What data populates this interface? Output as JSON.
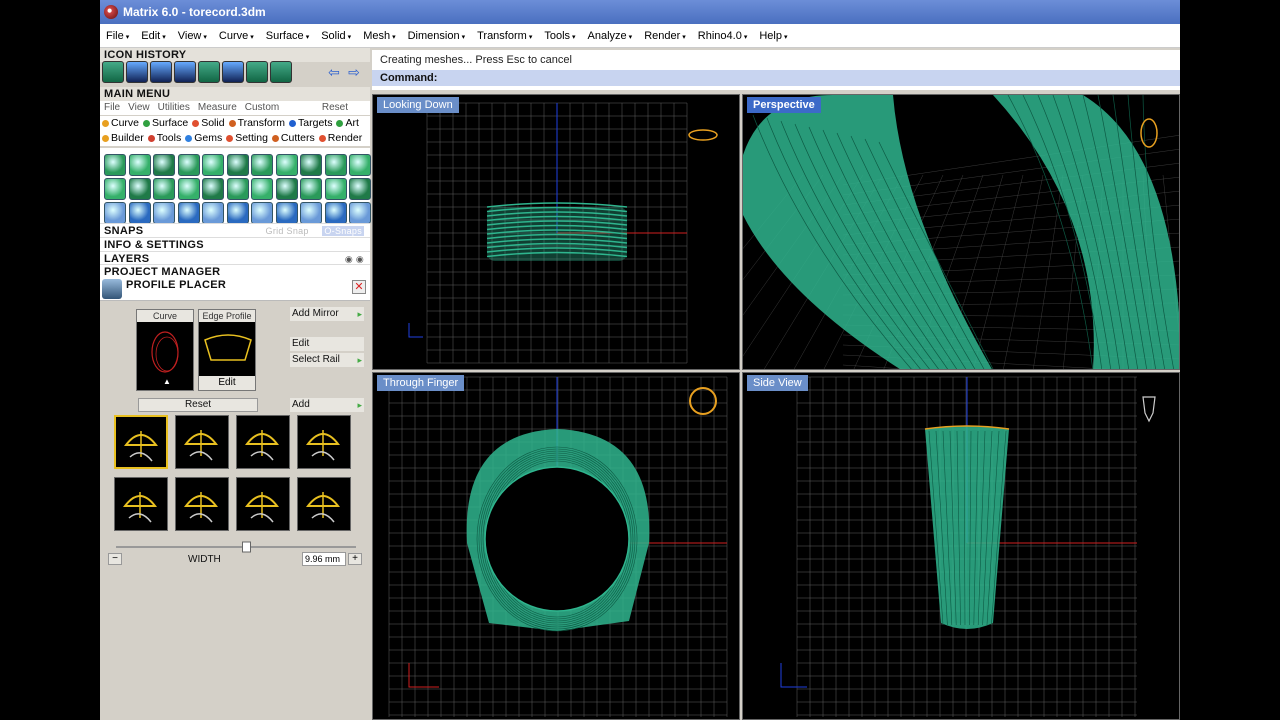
{
  "window": {
    "title": "Matrix 6.0 - torecord.3dm"
  },
  "menu": [
    "File",
    "Edit",
    "View",
    "Curve",
    "Surface",
    "Solid",
    "Mesh",
    "Dimension",
    "Transform",
    "Tools",
    "Analyze",
    "Render",
    "Rhino4.0",
    "Help"
  ],
  "icon_history": {
    "title": "ICON HISTORY"
  },
  "main_menu": {
    "title": "MAIN MENU",
    "submenu": [
      "File",
      "View",
      "Utilities",
      "Measure",
      "Custom"
    ],
    "reset": "Reset",
    "categories_row1": [
      {
        "label": "Curve",
        "color": "#e8a020"
      },
      {
        "label": "Surface",
        "color": "#30a040"
      },
      {
        "label": "Solid",
        "color": "#e05030"
      },
      {
        "label": "Transform",
        "color": "#d06020"
      },
      {
        "label": "Targets",
        "color": "#2060d0"
      },
      {
        "label": "Art",
        "color": "#30a040"
      }
    ],
    "categories_row2": [
      {
        "label": "Builder",
        "color": "#e8a020"
      },
      {
        "label": "Tools",
        "color": "#d04030"
      },
      {
        "label": "Gems",
        "color": "#3080e0"
      },
      {
        "label": "Setting",
        "color": "#e05030"
      },
      {
        "label": "Cutters",
        "color": "#d06020"
      },
      {
        "label": "Render",
        "color": "#e05030"
      }
    ]
  },
  "panels": {
    "snaps": "SNAPS",
    "snaps_grid": "Grid Snap",
    "snaps_osnap": "O-Snaps",
    "info": "INFO & SETTINGS",
    "layers": "LAYERS",
    "project": "PROJECT MANAGER"
  },
  "profile_placer": {
    "title": "PROFILE PLACER",
    "curve_label": "Curve",
    "edge_label": "Edge Profile",
    "edit_thumb": "Edit",
    "add_mirror": "Add Mirror",
    "edit": "Edit",
    "select_rail": "Select Rail",
    "reset": "Reset",
    "add": "Add",
    "width_label": "WIDTH",
    "width_value": "9.96 mm",
    "width_fraction": 0.55
  },
  "command": {
    "prompt": "Creating meshes... Press Esc to cancel",
    "label": "Command:"
  },
  "viewports": [
    {
      "label": "Looking Down"
    },
    {
      "label": "Perspective"
    },
    {
      "label": "Through Finger"
    },
    {
      "label": "Side View"
    }
  ],
  "colors": {
    "mesh": "#2fb58e",
    "mesh_dark": "#0d5a44",
    "grid": "#7a7a7a",
    "axis_red": "#d02020",
    "axis_blue": "#2040e0",
    "gizmo": "#e8a020"
  }
}
